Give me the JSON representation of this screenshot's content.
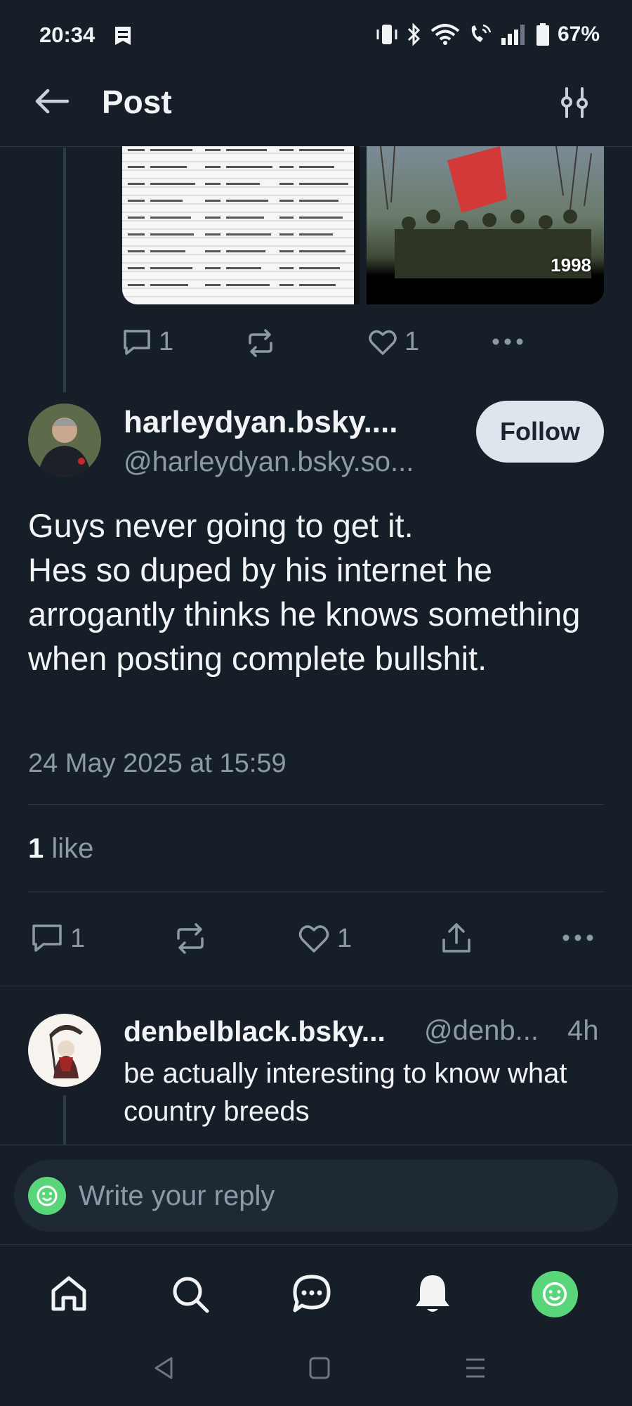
{
  "status_bar": {
    "time": "20:34",
    "battery": "67%",
    "icons": [
      "notification-icon",
      "vibrate-icon",
      "bluetooth-icon",
      "wifi-icon",
      "call-icon",
      "signal-icon",
      "battery-icon"
    ]
  },
  "header": {
    "title": "Post",
    "back_icon": "back-arrow-icon",
    "settings_icon": "sliders-icon"
  },
  "previous_post": {
    "photo_caption": "1998",
    "reply_count": "1",
    "like_count": "1"
  },
  "main_post": {
    "display_name": "harleydyan.bsky....",
    "handle": "@harleydyan.bsky.so...",
    "follow_label": "Follow",
    "text": "Guys never going to get it.\nHes so duped by his internet he arrogantly thinks he knows something when posting complete bullshit.",
    "date": "24 May 2025 at 15:59",
    "likes_number": "1",
    "likes_word": "like",
    "reply_count": "1",
    "like_count": "1"
  },
  "reply": {
    "display_name": "denbelblack.bsky...",
    "handle": "@denb...",
    "time": "4h",
    "text": "be actually interesting to know what country breeds"
  },
  "composer": {
    "placeholder": "Write your reply"
  },
  "bottom_nav": [
    "home-icon",
    "search-icon",
    "chat-icon",
    "notifications-icon",
    "profile-icon"
  ],
  "colors": {
    "background": "#161e27",
    "muted": "#8c9aa8",
    "accent": "#5ad67a",
    "follow_bg": "#dfe5ec"
  }
}
